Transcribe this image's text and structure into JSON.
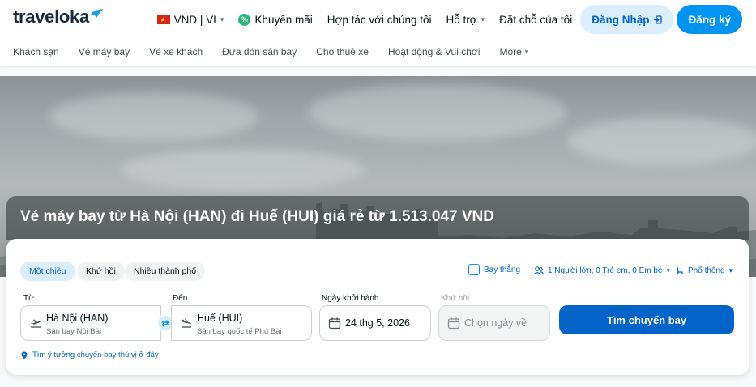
{
  "header": {
    "logo_text": "traveloka",
    "currency_lang": "VND | VI",
    "promotions": "Khuyến mãi",
    "partner": "Hợp tác với chúng tôi",
    "support": "Hỗ trợ",
    "bookings": "Đặt chỗ của tôi",
    "login": "Đăng Nhập",
    "register": "Đăng ký"
  },
  "subnav": {
    "items": [
      "Khách sạn",
      "Vé máy bay",
      "Vé xe khách",
      "Đưa đón sân bay",
      "Cho thuê xe",
      "Hoạt động & Vui chơi",
      "More"
    ]
  },
  "hero": {
    "title": "Vé máy bay từ Hà Nội (HAN) đi Huế (HUI) giá rẻ từ 1.513.047 VND"
  },
  "search": {
    "trip_types": [
      "Một chiều",
      "Khứ hồi",
      "Nhiều thành phố"
    ],
    "direct_flight": "Bay thẳng",
    "passengers": "1 Người lớn, 0 Trẻ em, 0 Em bé",
    "cabin_class": "Phổ thông",
    "from_label": "Từ",
    "from_city": "Hà Nội (HAN)",
    "from_airport": "Sân bay Nội Bài",
    "to_label": "Đến",
    "to_city": "Huế (HUI)",
    "to_airport": "Sân bay quốc tế Phú Bài",
    "depart_label": "Ngày khởi hành",
    "depart_date": "24 thg 5, 2026",
    "return_label": "Khứ hồi",
    "return_placeholder": "Chọn ngày về",
    "search_button": "Tìm chuyến bay",
    "idea_link": "Tìm ý tưởng chuyến bay thú vị ở đây"
  },
  "colors": {
    "brand_blue": "#0194f3",
    "dark_blue": "#0264c8",
    "light_blue": "#dbeefb"
  }
}
